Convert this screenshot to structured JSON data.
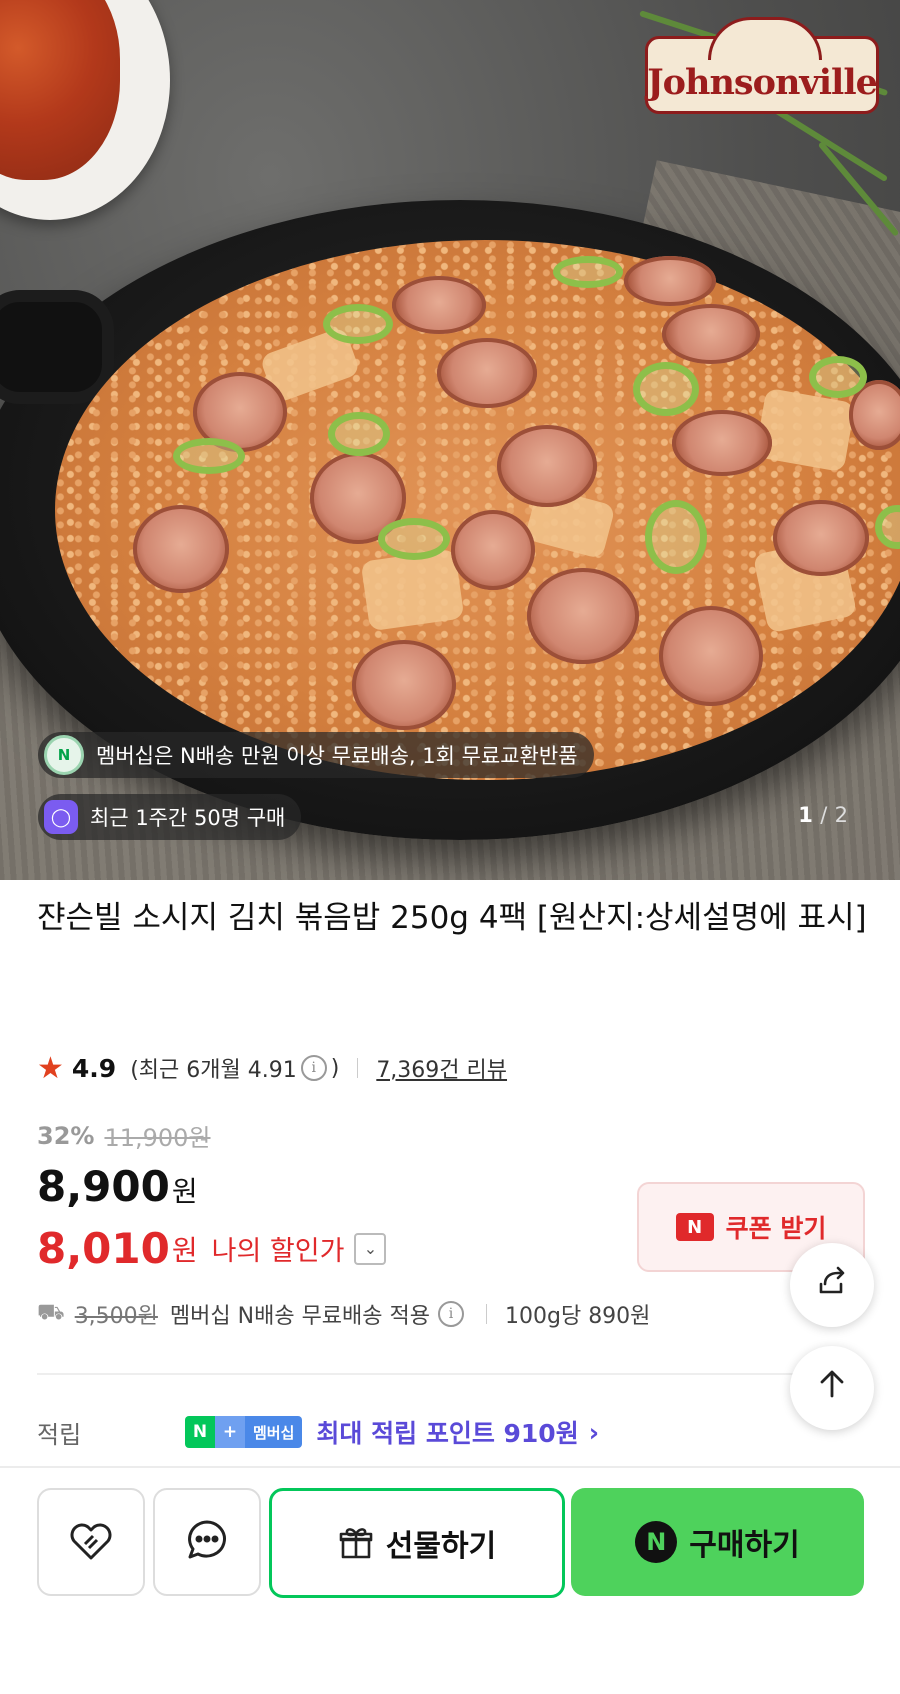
{
  "hero": {
    "brand_logo": "Johnsonville",
    "membership_notice": "멤버십은 N배송 만원 이상 무료배송, 1회 무료교환반품",
    "recent_buyers": "최근 1주간 50명 구매",
    "image_index": "1",
    "image_sep": "/",
    "image_total": "2"
  },
  "product": {
    "title": "쟌슨빌 소시지 김치 볶음밥 250g 4팩 [원산지:상세설명에 표시]",
    "rating": "4.9",
    "rating_detail_prefix": "(최근 6개월 4.91",
    "rating_detail_suffix": ")",
    "review_count": "7,369건 리뷰",
    "discount_pct": "32%",
    "original_price": "11,900원",
    "price": "8,900",
    "price_unit": "원",
    "my_price": "8,010",
    "my_price_unit": "원",
    "my_price_label": "나의 할인가",
    "coupon_badge": "N",
    "coupon_label": "쿠폰 받기",
    "shipping_fee": "3,500원",
    "shipping_text": "멤버십 N배송 무료배송 적용",
    "unit_price": "100g당 890원",
    "points_label": "적립",
    "points_badge_n": "N",
    "points_badge_plus": "+",
    "points_badge_mem": "멤버십",
    "points_text": "최대 적립 포인트 910원"
  },
  "actions": {
    "gift_label": "선물하기",
    "buy_label": "구매하기",
    "buy_badge": "N"
  },
  "icons": {
    "membership": "naver-n-icon",
    "buyers": "shopping-bag-icon",
    "share": "share-icon",
    "top": "arrow-up-icon",
    "like": "heart-icon",
    "chat": "chat-bubble-icon",
    "gift": "gift-icon",
    "truck": "truck-icon"
  },
  "colors": {
    "naver_green": "#03c75a",
    "buy_green": "#4ed25c",
    "discount_red": "#e0292b",
    "points_purple": "#5a4ad8",
    "star": "#e1411f"
  }
}
